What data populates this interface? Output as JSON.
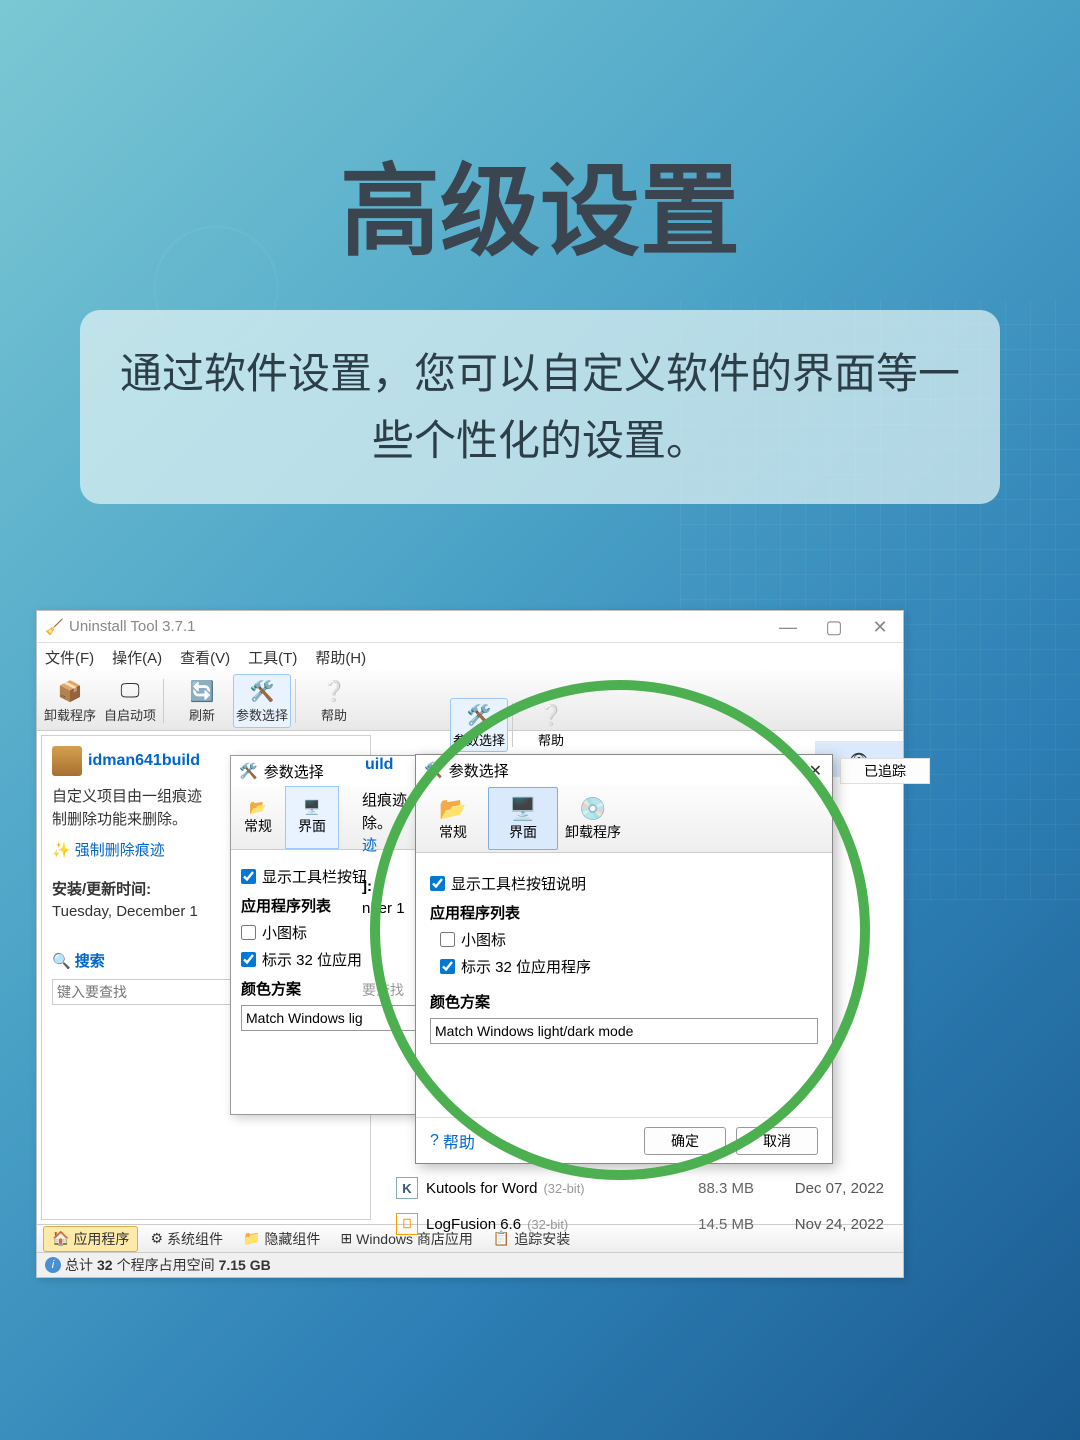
{
  "page": {
    "title": "高级设置",
    "subtitle": "通过软件设置，您可以自定义软件的界面等一些个性化的设置。"
  },
  "app": {
    "window_title": "Uninstall Tool 3.7.1",
    "menus": [
      "文件(F)",
      "操作(A)",
      "查看(V)",
      "工具(T)",
      "帮助(H)"
    ],
    "toolbar": {
      "uninstall": "卸载程序",
      "startup": "自启动项",
      "refresh": "刷新",
      "prefs": "参数选择",
      "help": "帮助"
    },
    "toolbar2": {
      "prefs": "参数选择",
      "help": "帮助"
    },
    "left": {
      "pkg_name": "idman641build",
      "desc1": "自定义项目由一组痕迹",
      "desc2": "制删除功能来删除。",
      "force_del": "强制删除痕迹",
      "install_label": "安装/更新时间:",
      "install_date": "Tuesday, December 1",
      "search_label": "搜索",
      "search_placeholder": "键入要查找"
    },
    "list_header": {
      "tracked": "已追踪"
    },
    "rows": [
      {
        "name": "Kutools for Word",
        "bits": "(32-bit)",
        "size": "88.3 MB",
        "date": "Dec 07, 2022"
      },
      {
        "name": "LogFusion 6.6",
        "bits": "(32-bit)",
        "size": "14.5 MB",
        "date": "Nov 24, 2022"
      }
    ],
    "tabs": {
      "apps": "应用程序",
      "syscomp": "系统组件",
      "hidden": "隐藏组件",
      "store": "Windows 商店应用",
      "track": "追踪安装"
    },
    "status": {
      "label_pre": "总计",
      "count": "32",
      "label_mid": "个程序占用空间",
      "size": "7.15 GB"
    }
  },
  "dialog_back": {
    "title": "参数选择",
    "tab_general": "常规",
    "tab_ui": "界面",
    "extra_label1": "组痕迹",
    "extra_label2": "除。",
    "extra_label3": "迹",
    "show_tooltips": "显示工具栏按钮",
    "app_list": "应用程序列表",
    "small_icons": "小图标",
    "mark_32": "标示 32 位应用",
    "color_scheme": "颜色方案",
    "combo": "Match Windows lig",
    "extra_right1": "]:",
    "extra_right2": "nber 1",
    "extra_right3": "要查找"
  },
  "dialog_front": {
    "title": "参数选择",
    "tab_general": "常规",
    "tab_ui": "界面",
    "tab_uninstall": "卸载程序",
    "show_tooltips": "显示工具栏按钮说明",
    "app_list": "应用程序列表",
    "small_icons": "小图标",
    "mark_32": "标示 32 位应用程序",
    "color_scheme": "颜色方案",
    "combo": "Match Windows light/dark mode",
    "help": "帮助",
    "ok": "确定",
    "cancel": "取消"
  }
}
